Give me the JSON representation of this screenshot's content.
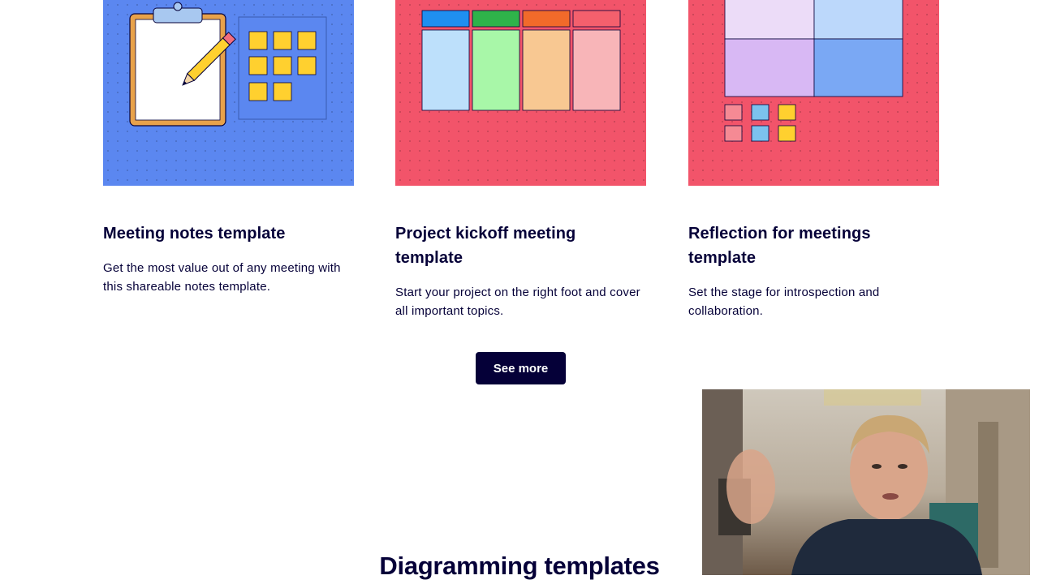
{
  "cards": [
    {
      "title": "Meeting notes template",
      "description": "Get the most value out of any meeting with this shareable notes template.",
      "thumbnail_color": "#5b87f0",
      "thumbnail_icon": "clipboard-notes-illustration"
    },
    {
      "title": "Project kickoff meeting template",
      "description": "Start your project on the right foot and cover all important topics.",
      "thumbnail_color": "#f2546a",
      "thumbnail_icon": "kanban-columns-illustration"
    },
    {
      "title": "Reflection for meetings template",
      "description": "Set the stage for introspection and collaboration.",
      "thumbnail_color": "#f2546a",
      "thumbnail_icon": "quadrant-grid-illustration"
    }
  ],
  "see_more_label": "See more",
  "section_heading": "Diagramming templates",
  "video_overlay": {
    "icon": "webcam-presenter-video"
  },
  "colors": {
    "text": "#050038",
    "button_bg": "#050038",
    "button_text": "#ffffff",
    "sticky_yellow": "#ffd02f",
    "blue_bg": "#5b87f0",
    "red_bg": "#f2546a"
  }
}
